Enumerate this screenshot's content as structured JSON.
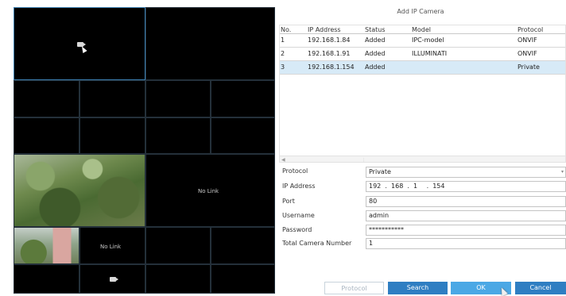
{
  "dialog": {
    "title": "Add IP Camera",
    "table": {
      "headers": [
        "No.",
        "IP Address",
        "Status",
        "Model",
        "Protocol"
      ],
      "rows": [
        {
          "no": "1",
          "ip": "192.168.1.84",
          "status": "Added",
          "model": "IPC-model",
          "protocol": "ONVIF"
        },
        {
          "no": "2",
          "ip": "192.168.1.91",
          "status": "Added",
          "model": "ILLUMINATI",
          "protocol": "ONVIF"
        },
        {
          "no": "3",
          "ip": "192.168.1.154",
          "status": "Added",
          "model": "",
          "protocol": "Private"
        }
      ],
      "selected_row": 3
    },
    "form": {
      "protocol_label": "Protocol",
      "protocol_value": "Private",
      "ip_label": "IP Address",
      "ip_segments": [
        "192",
        "168",
        "1",
        "154"
      ],
      "port_label": "Port",
      "port_value": "80",
      "username_label": "Username",
      "username_value": "admin",
      "password_label": "Password",
      "password_value": "***********",
      "total_label": "Total Camera Number",
      "total_value": "1"
    },
    "buttons": {
      "protocol": "Protocol",
      "search": "Search",
      "ok": "OK",
      "cancel": "Cancel"
    }
  },
  "grid": {
    "no_link_text": "No Link"
  },
  "colors": {
    "accent_blue": "#2f7ec2",
    "ok_blue": "#4ba8e5",
    "selected_row": "#d7eaf7"
  }
}
